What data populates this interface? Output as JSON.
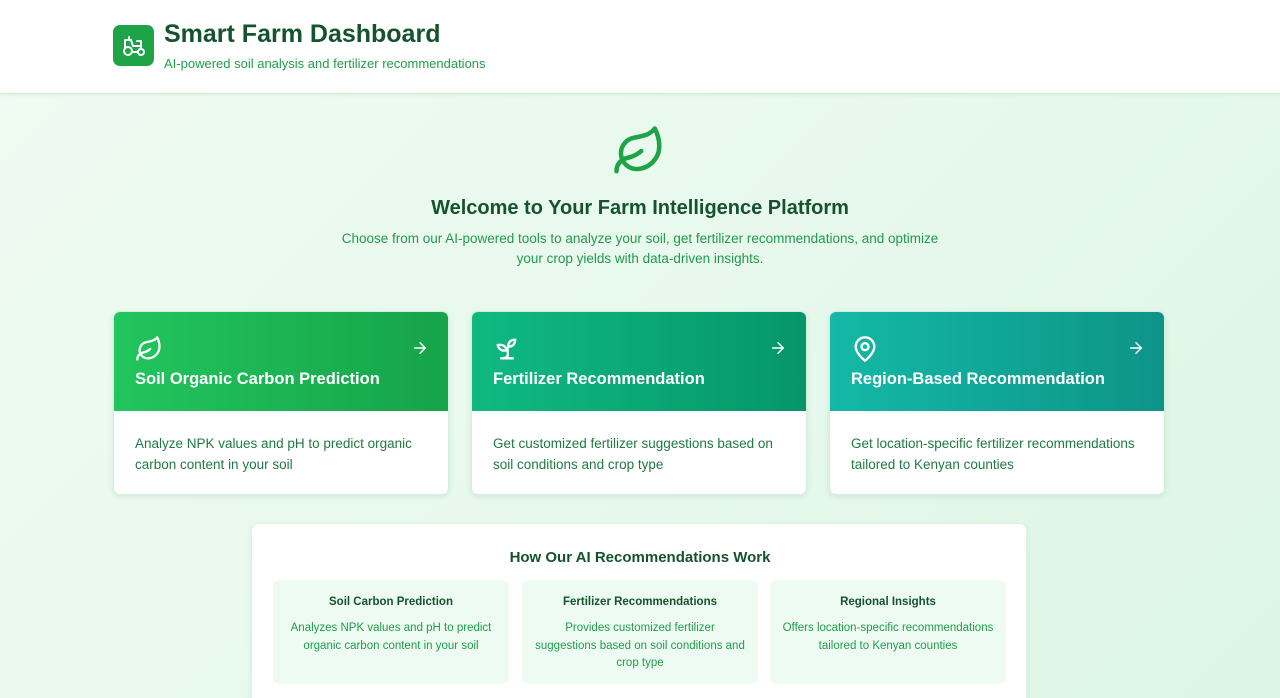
{
  "header": {
    "title": "Smart Farm Dashboard",
    "subtitle": "AI-powered soil analysis and fertilizer recommendations",
    "logo_icon": "tractor-icon"
  },
  "hero": {
    "icon": "leaf-icon",
    "title": "Welcome to Your Farm Intelligence Platform",
    "description": "Choose from our AI-powered tools to analyze your soil, get fertilizer recommendations, and optimize your crop yields with data-driven insights."
  },
  "cards": [
    {
      "icon": "leaf-icon",
      "title": "Soil Organic Carbon Prediction",
      "description": "Analyze NPK values and pH to predict organic carbon content in your soil",
      "gradient": [
        "#22c55e",
        "#16a34a"
      ]
    },
    {
      "icon": "sprout-icon",
      "title": "Fertilizer Recommendation",
      "description": "Get customized fertilizer suggestions based on soil conditions and crop type",
      "gradient": [
        "#10b981",
        "#059669"
      ]
    },
    {
      "icon": "map-pin-icon",
      "title": "Region-Based Recommendation",
      "description": "Get location-specific fertilizer recommendations tailored to Kenyan counties",
      "gradient": [
        "#14b8a6",
        "#0d9488"
      ]
    }
  ],
  "how_it_works": {
    "title": "How Our AI Recommendations Work",
    "items": [
      {
        "title": "Soil Carbon Prediction",
        "description": "Analyzes NPK values and pH to predict organic carbon content in your soil"
      },
      {
        "title": "Fertilizer Recommendations",
        "description": "Provides customized fertilizer suggestions based on soil conditions and crop type"
      },
      {
        "title": "Regional Insights",
        "description": "Offers location-specific recommendations tailored to Kenyan counties"
      }
    ]
  },
  "colors": {
    "primary_dark": "#14532d",
    "primary": "#16a34a",
    "accent_text": "#1f9e4a",
    "background": "#e6f8ec"
  }
}
